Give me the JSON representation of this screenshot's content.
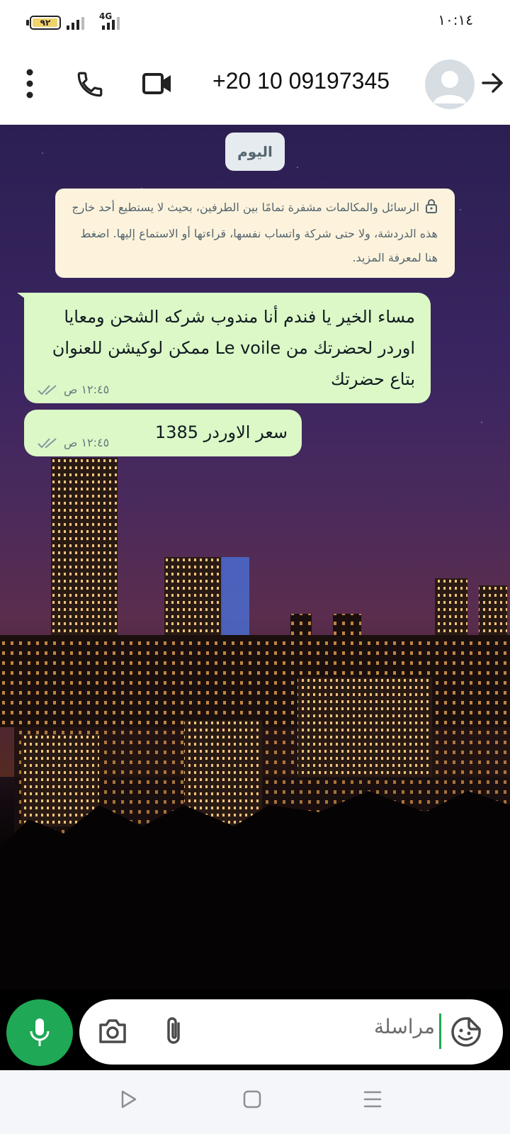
{
  "status_bar": {
    "time": "١٠:١٤",
    "battery_level": "٩٢",
    "network_type": "4G",
    "icons": [
      "battery-icon",
      "signal-icon",
      "network-4g-icon"
    ]
  },
  "header": {
    "contact_name": "+20 10 09197345",
    "icons": [
      "back-arrow-icon",
      "avatar-icon",
      "video-call-icon",
      "voice-call-icon",
      "more-options-icon"
    ]
  },
  "chat": {
    "date_label": "اليوم",
    "encryption_notice": "الرسائل والمكالمات مشفرة تمامًا بين الطرفين، بحيث لا يستطيع أحد خارج هذه الدردشة، ولا حتى شركة واتساب نفسها، قراءتها أو الاستماع إليها. اضغط هنا لمعرفة المزيد.",
    "messages": [
      {
        "text": "مساء الخير يا فندم أنا مندوب شركه الشحن ومعايا اوردر لحضرتك من Le voile ممكن لوكيشن للعنوان بتاع حضرتك",
        "time": "١٢:٤٥ ص",
        "status_icon": "double-check-icon"
      },
      {
        "text": "سعر الاوردر 1385",
        "time": "١٢:٤٥ ص",
        "status_icon": "double-check-icon"
      }
    ]
  },
  "input_bar": {
    "placeholder": "مراسلة",
    "icons": [
      "mic-icon",
      "camera-icon",
      "attach-icon",
      "sticker-icon"
    ],
    "accent_color": "#1fa855"
  },
  "nav_bar": {
    "icons": [
      "back-nav-icon",
      "home-nav-icon",
      "recents-nav-icon"
    ]
  },
  "colors": {
    "outgoing_bubble": "#dbf8c6",
    "notice_bg": "#fdf3dc",
    "date_pill_bg": "#e6ebef",
    "mic_button": "#1fa855"
  }
}
